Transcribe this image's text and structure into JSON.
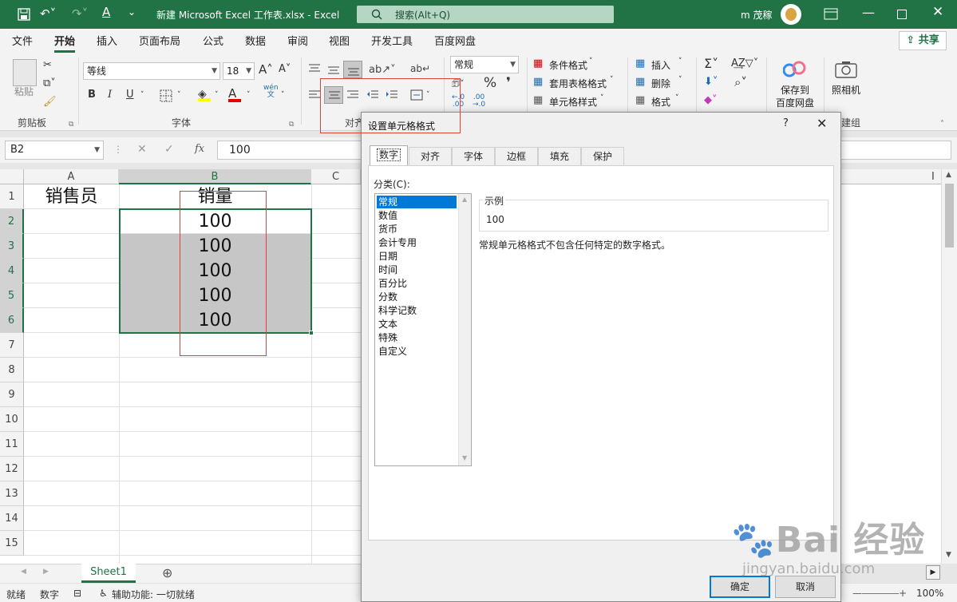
{
  "app": {
    "window_title": "新建 Microsoft Excel 工作表.xlsx  -  Excel",
    "search_placeholder": "搜索(Alt+Q)",
    "user_name": "m 茂稼",
    "accent": "#217346"
  },
  "menu": {
    "items": [
      "文件",
      "开始",
      "插入",
      "页面布局",
      "公式",
      "数据",
      "审阅",
      "视图",
      "开发工具",
      "百度网盘"
    ],
    "active": "开始",
    "share": "共享"
  },
  "ribbon": {
    "clipboard": {
      "paste": "粘贴",
      "label": "剪贴板"
    },
    "font": {
      "name": "等线",
      "size": "18",
      "bold": "B",
      "italic": "I",
      "underline": "U",
      "label": "字体",
      "wen": "wén\n文"
    },
    "align": {
      "label": "对齐"
    },
    "number": {
      "format": "常规",
      "percent": "%"
    },
    "styles": {
      "conditional": "条件格式",
      "table": "套用表格格式",
      "cell": "单元格样式"
    },
    "cells": {
      "insert": "插入",
      "delete": "删除",
      "format": "格式"
    },
    "baidu": {
      "save": "保存到",
      "save2": "百度网盘"
    },
    "camera": {
      "label": "照相机",
      "group": "建组"
    }
  },
  "formula_bar": {
    "name_box": "B2",
    "content": "100"
  },
  "sheet": {
    "columns": [
      "A",
      "B",
      "C"
    ],
    "rows": [
      "1",
      "2",
      "3",
      "4",
      "5",
      "6",
      "7",
      "8",
      "9",
      "10",
      "11",
      "12",
      "13",
      "14",
      "15"
    ],
    "cells": {
      "A1": "销售员",
      "B1": "销量",
      "B2": "100",
      "B3": "100",
      "B4": "100",
      "B5": "100",
      "B6": "100"
    },
    "right_col": "I",
    "tab": "Sheet1"
  },
  "dialog": {
    "title": "设置单元格格式",
    "help": "?",
    "tabs": [
      "数字",
      "对齐",
      "字体",
      "边框",
      "填充",
      "保护"
    ],
    "category_label": "分类(C):",
    "categories": [
      "常规",
      "数值",
      "货币",
      "会计专用",
      "日期",
      "时间",
      "百分比",
      "分数",
      "科学记数",
      "文本",
      "特殊",
      "自定义"
    ],
    "selected_category": "常规",
    "sample_label": "示例",
    "sample_value": "100",
    "description": "常规单元格格式不包含任何特定的数字格式。",
    "ok": "确定",
    "cancel": "取消"
  },
  "status": {
    "ready": "就绪",
    "numeric": "数字",
    "accessibility": "辅助功能: 一切就绪",
    "zoom": "100%"
  },
  "watermark": {
    "brand": "Bai 经验",
    "url": "jingyan.baidu.com"
  }
}
